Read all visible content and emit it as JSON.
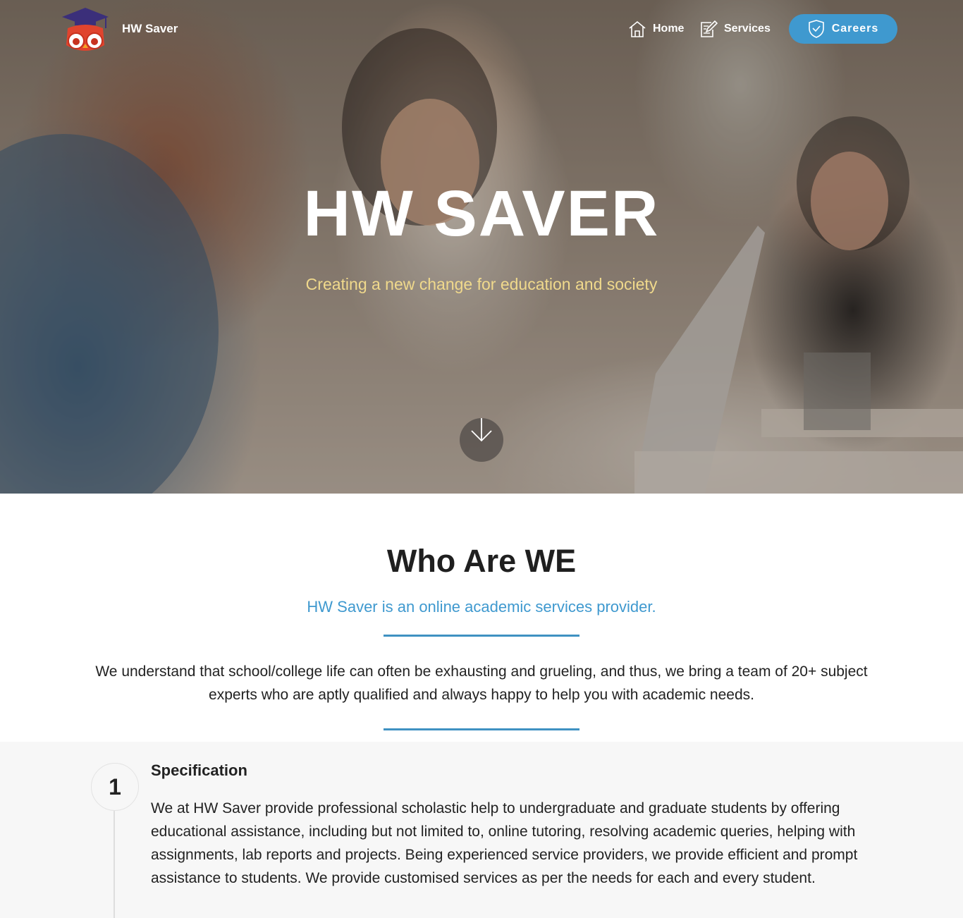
{
  "nav": {
    "brand": "HW Saver",
    "links": [
      {
        "label": "Home",
        "icon": "house-icon"
      },
      {
        "label": "Services",
        "icon": "edit-document-icon"
      }
    ],
    "cta": {
      "label": "Careers",
      "icon": "shield-icon"
    }
  },
  "hero": {
    "title": "HW SAVER",
    "subtitle": "Creating a new change for education and society",
    "scroll_icon": "arrow-down-icon"
  },
  "about": {
    "title": "Who Are WE",
    "tagline": "HW Saver is an online academic services provider.",
    "body": "We understand that school/college life can often be exhausting and grueling, and thus, we bring a team of 20+ subject experts who are aptly qualified and always happy to help you with academic needs."
  },
  "steps": [
    {
      "number": "1",
      "title": "Specification",
      "body": "We at HW Saver provide professional scholastic help to undergraduate and graduate students by offering educational assistance, including but not limited to, online tutoring, resolving academic queries, helping with assignments, lab reports and projects. Being experienced service providers, we provide efficient and prompt assistance to students. We provide customised services as per the needs for each and every student."
    }
  ],
  "colors": {
    "accent": "#3f99cf",
    "hero_subtitle": "#f0d98c",
    "section_bg": "#f7f7f7",
    "logo_cap": "#3b2f7a",
    "logo_owl": "#e0442e"
  }
}
